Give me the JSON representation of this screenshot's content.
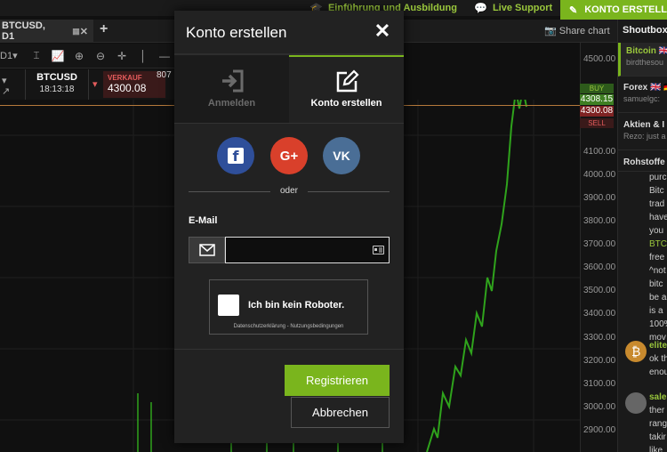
{
  "topbar": {
    "nav": [
      {
        "label": "Einführung und Ausbildung"
      },
      {
        "label": "Live Support"
      }
    ],
    "cta_label": "KONTO ERSTELLEN"
  },
  "chart": {
    "tab_label": "BTCUSD, D1",
    "share_label": "Share chart",
    "symbol": "BTCUSD",
    "time": "18:13:18",
    "sell_label": "VERKAUF",
    "sell_price": "4300.08",
    "quantity": "807",
    "timeframe": "D1",
    "buy_label": "BUY",
    "buy_price": "4308.15",
    "sell_axis_price": "4300.08",
    "sell_axis_label": "SELL",
    "axis_ticks": [
      "4500.00",
      "4100.00",
      "4000.00",
      "3900.00",
      "3800.00",
      "3700.00",
      "3600.00",
      "3500.00",
      "3400.00",
      "3300.00",
      "3200.00",
      "3100.00",
      "3000.00",
      "2900.00"
    ]
  },
  "shoutbox": {
    "title": "Shoutbox:",
    "rooms": [
      {
        "name": "Bitcoin 🇬🇧",
        "sub": "birdthesou"
      },
      {
        "name": "Forex 🇬🇧 🇩🇪",
        "sub": "samuelgc:"
      },
      {
        "name": "Aktien & I",
        "sub": "Rezo: just a"
      },
      {
        "name": "Rohstoffe",
        "sub": ""
      }
    ],
    "messages": [
      "purc",
      "Bitc",
      "trad",
      "have",
      "you",
      "BTC",
      "free",
      "^not",
      "bitc",
      "be a",
      "is a",
      "100%",
      "mov"
    ],
    "users": [
      {
        "name": "elite",
        "lines": [
          "ok th",
          "enou"
        ]
      },
      {
        "name": "sale",
        "lines": [
          "ther",
          "rang",
          "takir",
          "like"
        ]
      }
    ]
  },
  "modal": {
    "title": "Konto erstellen",
    "tabs": [
      {
        "label": "Anmelden"
      },
      {
        "label": "Konto erstellen"
      }
    ],
    "or_label": "oder",
    "email_label": "E-Mail",
    "email_value": "",
    "captcha_label": "Ich bin kein Roboter.",
    "captcha_links": "Datenschutzerklärung - Nutzungsbedingungen",
    "register_label": "Registrieren",
    "cancel_label": "Abbrechen"
  },
  "colors": {
    "accent": "#7ab51d",
    "sell": "#e45c5c",
    "facebook": "#2f4f9a",
    "google": "#d9402b",
    "vk": "#4a6e96"
  }
}
